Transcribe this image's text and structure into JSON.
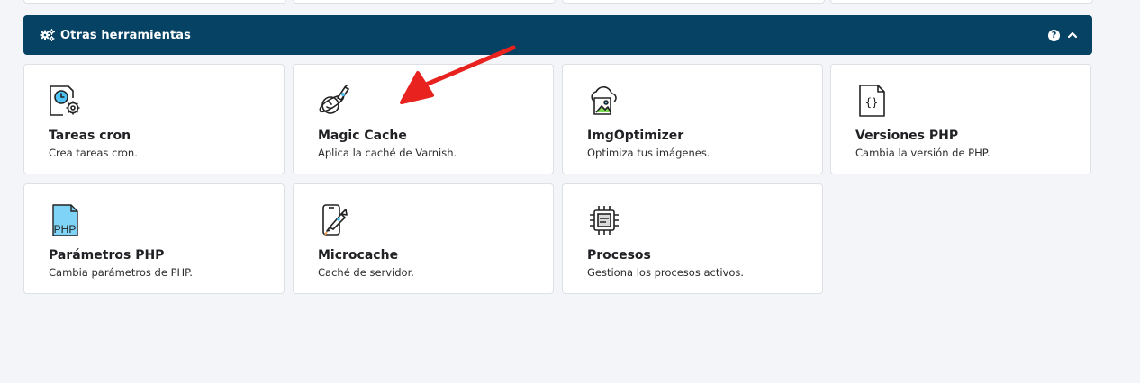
{
  "section": {
    "title": "Otras herramientas",
    "help_label": "?"
  },
  "cards": [
    {
      "title": "Tareas cron",
      "description": "Crea tareas cron.",
      "icon": "clock-gear-document-icon"
    },
    {
      "title": "Magic Cache",
      "description": "Aplica la caché de Varnish.",
      "icon": "planet-rocket-icon"
    },
    {
      "title": "ImgOptimizer",
      "description": "Optimiza tus imágenes.",
      "icon": "cloud-image-icon"
    },
    {
      "title": "Versiones PHP",
      "description": "Cambia la versión de PHP.",
      "icon": "code-document-icon"
    },
    {
      "title": "Parámetros PHP",
      "description": "Cambia parámetros de PHP.",
      "icon": "php-document-icon",
      "icon_text": "PHP"
    },
    {
      "title": "Microcache",
      "description": "Caché de servidor.",
      "icon": "phone-rocket-icon"
    },
    {
      "title": "Procesos",
      "description": "Gestiona los procesos activos.",
      "icon": "cpu-chip-icon"
    }
  ],
  "colors": {
    "header_bg": "#054263",
    "annotation_arrow": "#e8231f",
    "icon_accent": "#4fc3f7"
  }
}
